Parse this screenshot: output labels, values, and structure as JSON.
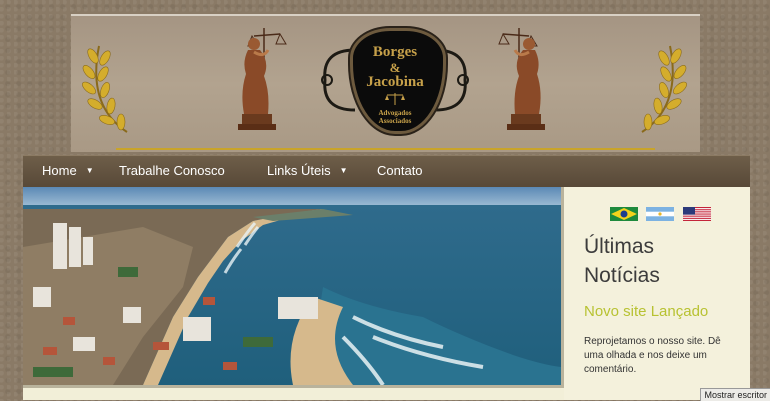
{
  "logo": {
    "name_line1": "Borges",
    "ampersand": "&",
    "name_line2": "Jacobina",
    "subtitle_line1": "Advogados",
    "subtitle_line2": "Associados"
  },
  "nav": {
    "items": [
      {
        "label": "Home",
        "has_dropdown": true
      },
      {
        "label": "Trabalhe Conosco",
        "has_dropdown": false
      },
      {
        "label": "Links Úteis",
        "has_dropdown": true
      },
      {
        "label": "Contato",
        "has_dropdown": false
      }
    ]
  },
  "sidebar": {
    "flags": [
      "brazil-flag-icon",
      "argentina-flag-icon",
      "usa-flag-icon"
    ],
    "title_line1": "Últimas",
    "title_line2": "Notícias",
    "news_title": "Novo site Lançado",
    "news_body": "Reprojetamos o nosso site. Dê uma olhada e nos deixe um comentário."
  },
  "statusbar": {
    "text": "Mostrar escritor"
  },
  "colors": {
    "nav_bg": "#5e4f3d",
    "gold": "#c9a42a",
    "news_accent": "#b8c232",
    "content_bg": "#f2efd8"
  }
}
